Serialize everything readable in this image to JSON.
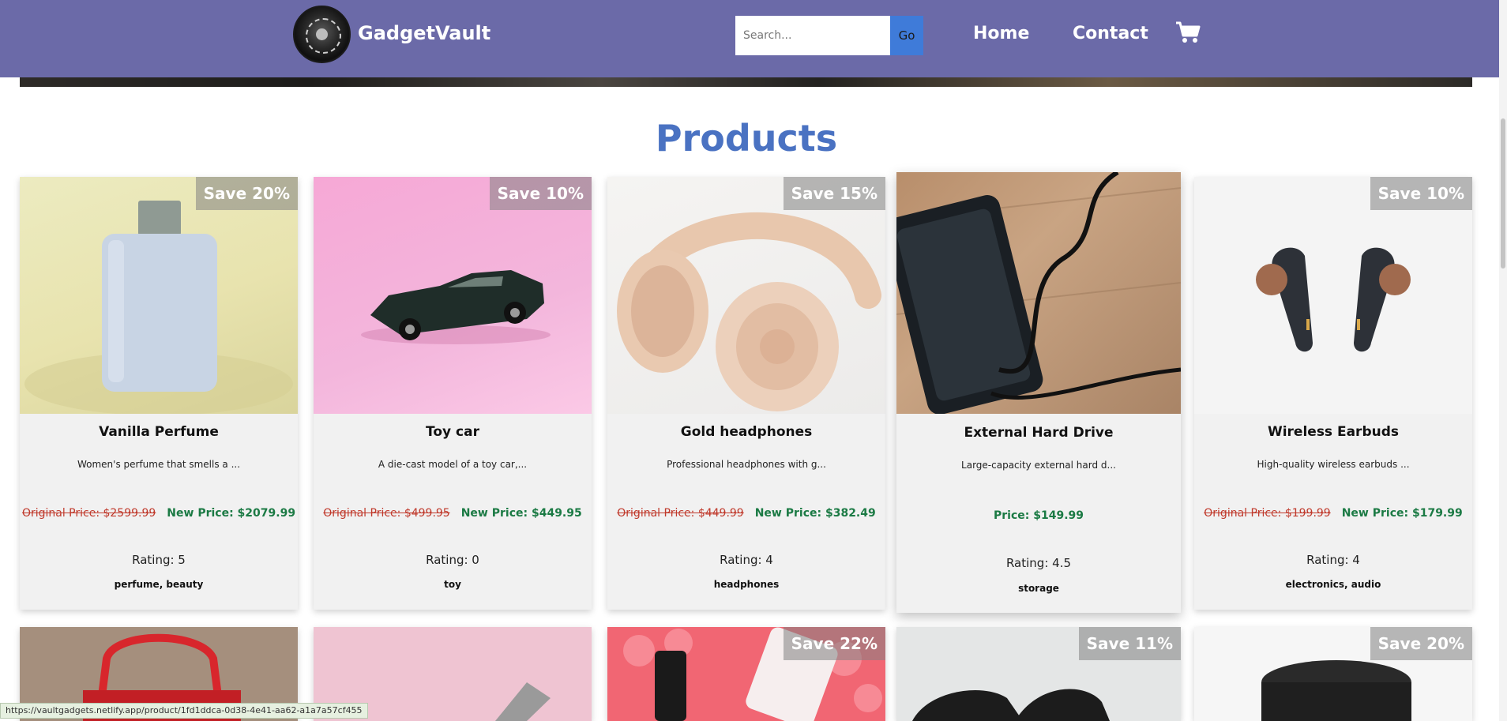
{
  "header": {
    "brand": "GadgetVault",
    "search_placeholder": "Search...",
    "go_label": "Go",
    "nav": [
      "Home",
      "Contact"
    ],
    "icons": [
      "logo",
      "cart-icon"
    ]
  },
  "section_title": "Products",
  "products": [
    {
      "badge": "Save 20%",
      "name": "Vanilla Perfume",
      "desc": "Women's perfume that smells a ...",
      "original": "Original Price: $2599.99",
      "new": "New Price: $2079.99",
      "rating": "Rating: 5",
      "tags": "perfume, beauty"
    },
    {
      "badge": "Save 10%",
      "name": "Toy car",
      "desc": "A die-cast model of a toy car,...",
      "original": "Original Price: $499.95",
      "new": "New Price: $449.95",
      "rating": "Rating: 0",
      "tags": "toy"
    },
    {
      "badge": "Save 15%",
      "name": "Gold headphones",
      "desc": "Professional headphones with g...",
      "original": "Original Price: $449.99",
      "new": "New Price: $382.49",
      "rating": "Rating: 4",
      "tags": "headphones"
    },
    {
      "badge": "",
      "name": "External Hard Drive",
      "desc": "Large-capacity external hard d...",
      "original": "",
      "new": "Price: $149.99",
      "rating": "Rating: 4.5",
      "tags": "storage"
    },
    {
      "badge": "Save 10%",
      "name": "Wireless Earbuds",
      "desc": "High-quality wireless earbuds ...",
      "original": "Original Price: $199.99",
      "new": "New Price: $179.99",
      "rating": "Rating: 4",
      "tags": "electronics, audio"
    }
  ],
  "second_row_badges": [
    "Save 22%",
    "Save 11%",
    "Save 20%"
  ],
  "status_url": "https://vaultgadgets.netlify.app/product/1fd1ddca-0d38-4e41-aa62-a1a7a57cf455",
  "colors": {
    "navbar": "#6b6aa8",
    "accent": "#4a72c2",
    "go_button": "#3f7bd9",
    "old_price": "#c0392b",
    "new_price": "#1b7a44"
  }
}
